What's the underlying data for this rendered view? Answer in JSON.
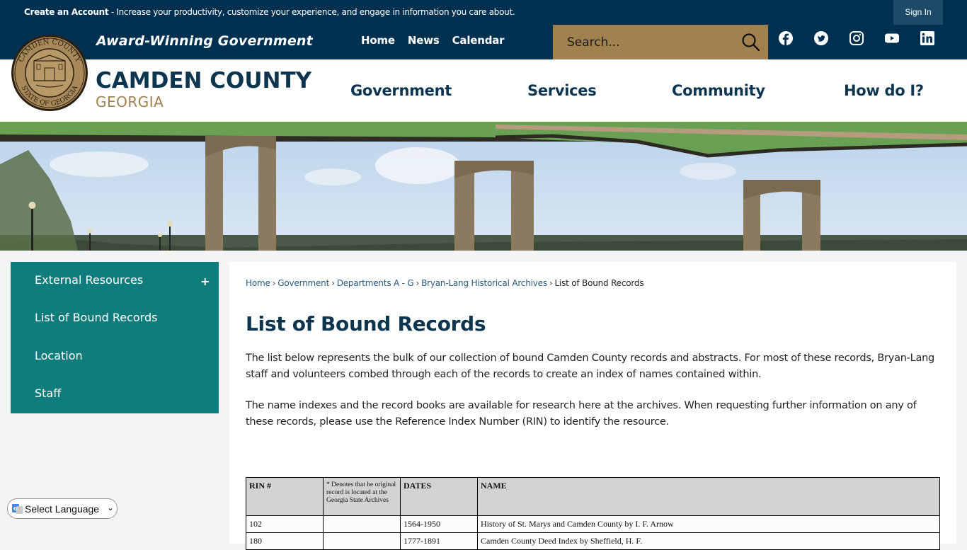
{
  "topbar": {
    "create_account": "Create an Account",
    "message": " - Increase your productivity, customize your experience, and engage in information you care about.",
    "sign_in": "Sign In"
  },
  "header": {
    "tagline": "Award-Winning Government",
    "brand_name": "CAMDEN COUNTY",
    "brand_state": "GEORGIA",
    "top_links": [
      "Home",
      "News",
      "Calendar"
    ],
    "search_placeholder": "Search...",
    "social": [
      "facebook",
      "twitter",
      "instagram",
      "youtube",
      "linkedin"
    ]
  },
  "main_nav": [
    "Government",
    "Services",
    "Community",
    "How do I?"
  ],
  "sidebar": {
    "items": [
      {
        "label": "External Resources",
        "expandable": true
      },
      {
        "label": "List of Bound Records"
      },
      {
        "label": "Location"
      },
      {
        "label": "Staff"
      }
    ]
  },
  "language": {
    "selected": "Select Language"
  },
  "breadcrumb": {
    "links": [
      "Home",
      "Government",
      "Departments A - G",
      "Bryan-Lang Historical Archives"
    ],
    "current": "List of Bound Records",
    "separator": "›"
  },
  "page": {
    "title": "List of Bound Records",
    "paragraphs": [
      "The list below represents the bulk of our collection of bound Camden County records and abstracts. For most of these records, Bryan-Lang staff and volunteers combed through each of the records to create an index of names contained within.",
      "The name indexes and the record books are available for research here at the archives. When requesting further information on any of these records, please use the Reference Index Number (RIN) to identify the resource."
    ]
  },
  "table": {
    "headers": [
      "RIN #",
      "* Denotes that he original record is located at the Georgia State Archives",
      "DATES",
      "NAME"
    ],
    "rows": [
      [
        "102",
        "",
        "1564-1950",
        "History of St. Marys and Camden County by I. F. Arnow"
      ],
      [
        "180",
        "",
        "1777-1891",
        "Camden County Deed Index by Sheffield, H. F."
      ]
    ]
  }
}
